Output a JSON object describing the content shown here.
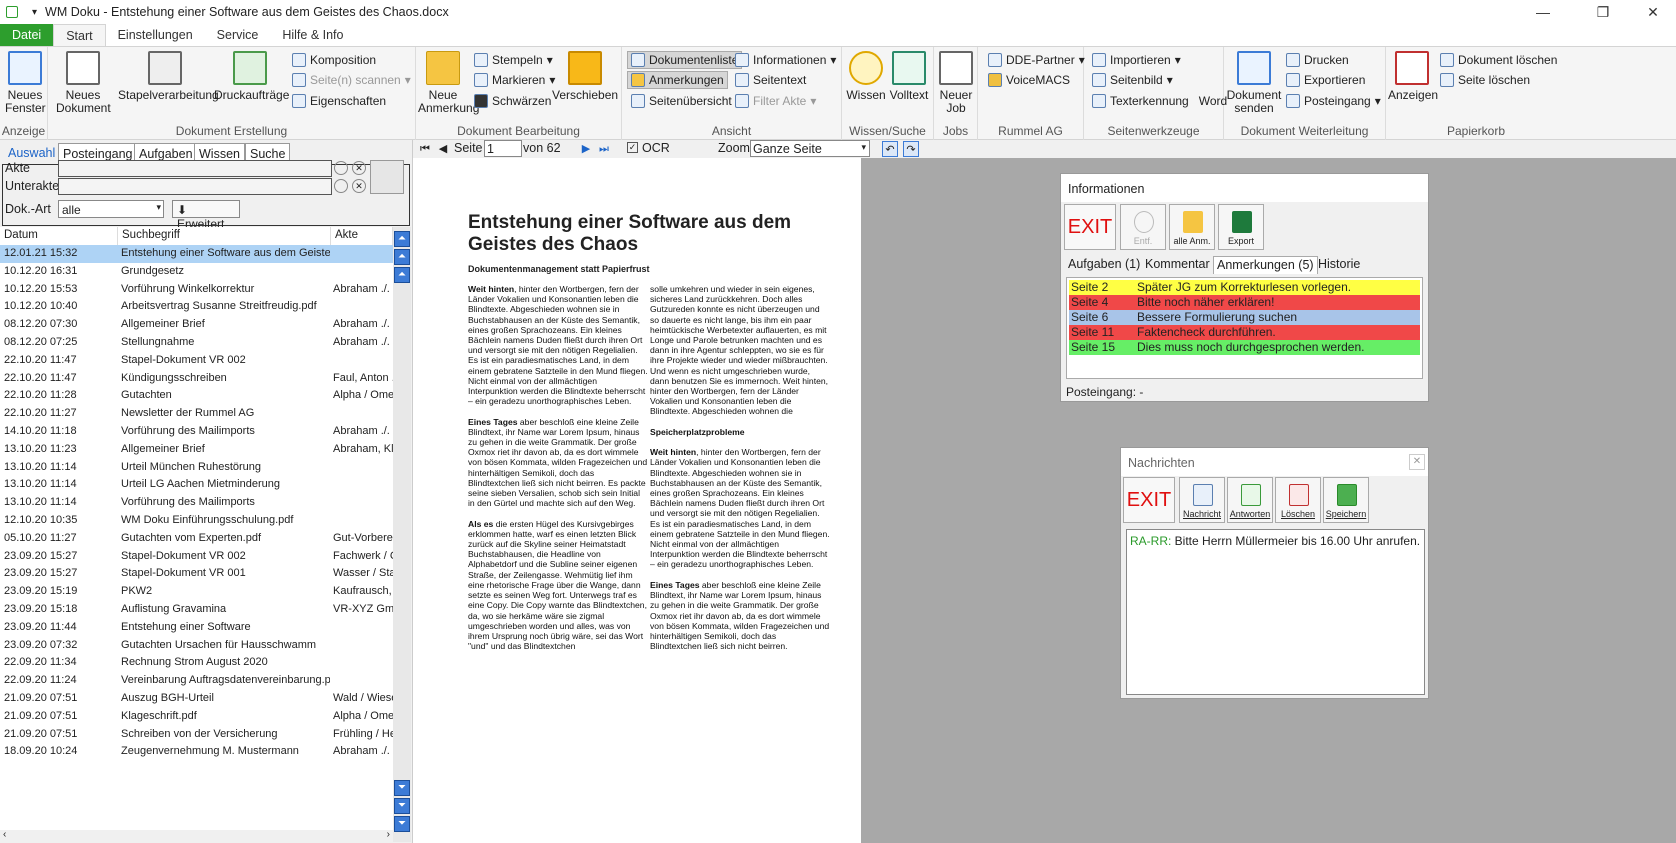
{
  "window": {
    "title": "WM Doku - Entstehung einer Software aus dem Geistes des Chaos.docx"
  },
  "tabs": [
    "Datei",
    "Start",
    "Einstellungen",
    "Service",
    "Hilfe & Info"
  ],
  "ribbon": {
    "anzeige": {
      "label": "Anzeige",
      "neues_fenster": "Neues Fenster"
    },
    "erstellung": {
      "label": "Dokument Erstellung",
      "neues_dokument": "Neues Dokument",
      "stapelverarbeitung": "Stapelverarbeitung",
      "druckauftraege": "Druckaufträge",
      "komposition": "Komposition",
      "seiten_scannen": "Seite(n) scannen",
      "eigenschaften": "Eigenschaften"
    },
    "bearbeitung": {
      "label": "Dokument Bearbeitung",
      "neue_anmerkung": "Neue Anmerkung",
      "stempeln": "Stempeln",
      "markieren": "Markieren",
      "schwaerzen": "Schwärzen",
      "verschieben": "Verschieben"
    },
    "ansicht": {
      "label": "Ansicht",
      "dokumentenliste": "Dokumentenliste",
      "anmerkungen": "Anmerkungen",
      "seitenuebersicht": "Seitenübersicht",
      "informationen": "Informationen",
      "seitentext": "Seitentext",
      "filter_akte": "Filter Akte"
    },
    "wissen": {
      "label": "Wissen/Suche",
      "wissen": "Wissen",
      "volltext": "Volltext"
    },
    "jobs": {
      "label": "Jobs",
      "neuer_job": "Neuer Job"
    },
    "rummel": {
      "label": "Rummel AG",
      "dde": "DDE-Partner",
      "voicemacs": "VoiceMACS"
    },
    "seitenwerkzeuge": {
      "label": "Seitenwerkzeuge",
      "importieren": "Importieren",
      "seitenbild": "Seitenbild",
      "texterkennung": "Texterkennung",
      "word": "Word"
    },
    "weiterleitung": {
      "label": "Dokument Weiterleitung",
      "dokument_senden": "Dokument senden",
      "drucken": "Drucken",
      "exportieren": "Exportieren",
      "posteingang": "Posteingang"
    },
    "papierkorb": {
      "label": "Papierkorb",
      "anzeigen": "Anzeigen",
      "dokument_loeschen": "Dokument löschen",
      "seite_loeschen": "Seite löschen"
    }
  },
  "left": {
    "tabs": [
      "Auswahl",
      "Posteingang",
      "Aufgaben",
      "Wissen",
      "Suche"
    ],
    "akte_label": "Akte",
    "unterakte_label": "Unterakte",
    "dokart_label": "Dok.-Art",
    "dokart_value": "alle",
    "erweitert": "Erweitert",
    "columns": [
      "Datum",
      "Suchbegriff",
      "Akte"
    ],
    "rows": [
      [
        "12.01.21 15:32",
        "Entstehung einer Software aus dem Geistes des Chaos",
        ""
      ],
      [
        "10.12.20 16:31",
        "Grundgesetz",
        ""
      ],
      [
        "10.12.20 15:53",
        "Vorführung Winkelkorrektur",
        "Abraham ./. M"
      ],
      [
        "10.12.20 10:40",
        "Arbeitsvertrag Susanne Streitfreudig.pdf",
        ""
      ],
      [
        "08.12.20 07:30",
        "Allgemeiner Brief",
        "Abraham ./. M"
      ],
      [
        "08.12.20 07:25",
        "Stellungnahme",
        "Abraham ./. M"
      ],
      [
        "22.10.20 11:47",
        "Stapel-Dokument VR 002",
        ""
      ],
      [
        "22.10.20 11:47",
        "Kündigungsschreiben",
        "Faul, Anton ./."
      ],
      [
        "22.10.20 11:28",
        "Gutachten",
        "Alpha / Omeg"
      ],
      [
        "22.10.20 11:27",
        "Newsletter der Rummel AG",
        ""
      ],
      [
        "14.10.20 11:18",
        "Vorführung des Mailimports",
        "Abraham ./. M"
      ],
      [
        "13.10.20 11:23",
        "Allgemeiner Brief",
        "Abraham, Kla"
      ],
      [
        "13.10.20 11:14",
        "Urteil München Ruhestörung",
        ""
      ],
      [
        "13.10.20 11:14",
        "Urteil LG Aachen Mietminderung",
        ""
      ],
      [
        "13.10.20 11:14",
        "Vorführung des Mailimports",
        ""
      ],
      [
        "12.10.20 10:35",
        "WM Doku Einführungsschulung.pdf",
        ""
      ],
      [
        "05.10.20 11:27",
        "Gutachten vom Experten.pdf",
        "Gut-Vorberei"
      ],
      [
        "23.09.20 15:27",
        "Stapel-Dokument VR 002",
        "Fachwerk / C"
      ],
      [
        "23.09.20 15:27",
        "Stapel-Dokument VR 001",
        "Wasser / Sta"
      ],
      [
        "23.09.20 15:19",
        "PKW2",
        "Kaufrausch,"
      ],
      [
        "23.09.20 15:18",
        "Auflistung Gravamina",
        "VR-XYZ Gmb"
      ],
      [
        "23.09.20 11:44",
        "Entstehung einer Software",
        ""
      ],
      [
        "23.09.20 07:32",
        "Gutachten Ursachen für Hausschwamm",
        ""
      ],
      [
        "22.09.20 11:34",
        "Rechnung Strom August 2020",
        ""
      ],
      [
        "22.09.20 11:24",
        "Vereinbarung Auftragsdatenvereinbarung.pdf",
        ""
      ],
      [
        "21.09.20 07:51",
        "Auszug BGH-Urteil",
        "Wald / Wiese"
      ],
      [
        "21.09.20 07:51",
        "Klageschrift.pdf",
        "Alpha / Omeg"
      ],
      [
        "21.09.20 07:51",
        "Schreiben von der Versicherung",
        "Frühling / Her"
      ],
      [
        "18.09.20 10:24",
        "Zeugenvernehmung M. Mustermann",
        "Abraham ./. M"
      ]
    ]
  },
  "doctoolbar": {
    "seite": "Seite",
    "page": "1",
    "von": "von 62",
    "ocr": "OCR",
    "zoom": "Zoom",
    "zoom_value": "Ganze Seite"
  },
  "document": {
    "title": "Entstehung einer Software aus dem Geistes des Chaos",
    "subtitle": "Dokumentenmanagement statt Papierfrust",
    "col1_p1_b": "Weit hinten",
    "col1_p1": ", hinter den Wortbergen, fern der Länder Vokalien und Konsonantien leben die Blindtexte. Abgeschieden wohnen sie in Buchstabhausen an der Küste des Semantik, eines großen Sprachozeans. Ein kleines Bächlein namens Duden fließt durch ihren Ort und versorgt sie mit den nötigen Regelialien. Es ist ein paradiesmatisches Land, in dem einem gebratene Satzteile in den Mund fliegen. Nicht einmal von der allmächtigen Interpunktion werden die Blindtexte beherrscht – ein geradezu unorthographisches Leben.",
    "col1_p2_b": "Eines Tages",
    "col1_p2": " aber beschloß eine kleine Zeile Blindtext, ihr Name war Lorem Ipsum, hinaus zu gehen in die weite Grammatik. Der große Oxmox riet ihr davon ab, da es dort wimmele von bösen Kommata, wilden Fragezeichen und hinterhältigen Semikoli, doch das Blindtextchen ließ sich nicht beirren. Es packte seine sieben Versalien, schob sich sein Initial in den Gürtel und machte sich auf den Weg.",
    "col1_p3_b": "Als es",
    "col1_p3": " die ersten Hügel des Kursivgebirges erklommen hatte, warf es einen letzten Blick zurück auf die Skyline seiner Heimatstadt Buchstabhausen, die Headline von Alphabetdorf und die Subline seiner eigenen Straße, der Zeilengasse. Wehmütig lief ihm eine rhetorische Frage über die Wange, dann setzte es seinen Weg fort. Unterwegs traf es eine Copy. Die Copy warnte das Blindtextchen, da, wo sie herkäme wäre sie zigmal umgeschrieben worden und alles, was von ihrem Ursprung noch übrig wäre, sei das Wort \"und\" und das Blindtextchen",
    "col2_p1": "solle umkehren und wieder in sein eigenes, sicheres Land zurückkehren. Doch alles Gutzureden konnte es nicht überzeugen und so dauerte es nicht lange, bis ihm ein paar heimtückische Werbetexter auflauerten, es mit Longe und Parole betrunken machten und es dann in ihre Agentur schleppten, wo sie es für ihre Projekte wieder und wieder mißbrauchten. Und wenn es nicht umgeschrieben wurde, dann benutzen Sie es immernoch. Weit hinten, hinter den Wortbergen, fern der Länder Vokalien und Konsonantien leben die Blindtexte. Abgeschieden wohnen die",
    "col2_h": "Speicherplatzprobleme",
    "col2_p2_b": "Weit hinten",
    "col2_p2": ", hinter den Wortbergen, fern der Länder Vokalien und Konsonantien leben die Blindtexte. Abgeschieden wohnen sie in Buchstabhausen an der Küste des Semantik, eines großen Sprachozeans. Ein kleines Bächlein namens Duden fließt durch ihren Ort und versorgt sie mit den nötigen Regelialien. Es ist ein paradiesmatisches Land, in dem einem gebratene Satzteile in den Mund fliegen. Nicht einmal von der allmächtigen Interpunktion werden die Blindtexte beherrscht – ein geradezu unorthographisches Leben.",
    "col2_p3_b": "Eines Tages",
    "col2_p3": " aber beschloß eine kleine Zeile Blindtext, ihr Name war Lorem Ipsum, hinaus zu gehen in die weite Grammatik. Der große Oxmox riet ihr davon ab, da es dort wimmele von bösen Kommata, wilden Fragezeichen und hinterhältigen Semikoli, doch das Blindtextchen ließ sich nicht beirren."
  },
  "info": {
    "title": "Informationen",
    "exit": "EXIT",
    "entf": "Entf.",
    "alle_anm": "alle Anm.",
    "export": "Export",
    "tabs": [
      "Aufgaben (1)",
      "Kommentar",
      "Anmerkungen (5)",
      "Historie"
    ],
    "annotations": [
      {
        "page": "Seite 2",
        "text": "Später JG zum Korrekturlesen vorlegen.",
        "color": "#ffff44"
      },
      {
        "page": "Seite 4",
        "text": "Bitte noch näher erklären!",
        "color": "#f04848"
      },
      {
        "page": "Seite 6",
        "text": "Bessere Formulierung suchen",
        "color": "#a8c4e8"
      },
      {
        "page": "Seite 11",
        "text": "Faktencheck durchführen.",
        "color": "#f04848"
      },
      {
        "page": "Seite 15",
        "text": "Dies muss noch durchgesprochen werden.",
        "color": "#66ee66"
      }
    ],
    "posteingang": "Posteingang: -"
  },
  "messages": {
    "title": "Nachrichten",
    "exit": "EXIT",
    "nachricht": "Nachricht",
    "antworten": "Antworten",
    "loeschen": "Löschen",
    "speichern": "Speichern",
    "sender": "RA-RR:",
    "text": " Bitte Herrn Müllermeier bis 16.00 Uhr anrufen."
  }
}
